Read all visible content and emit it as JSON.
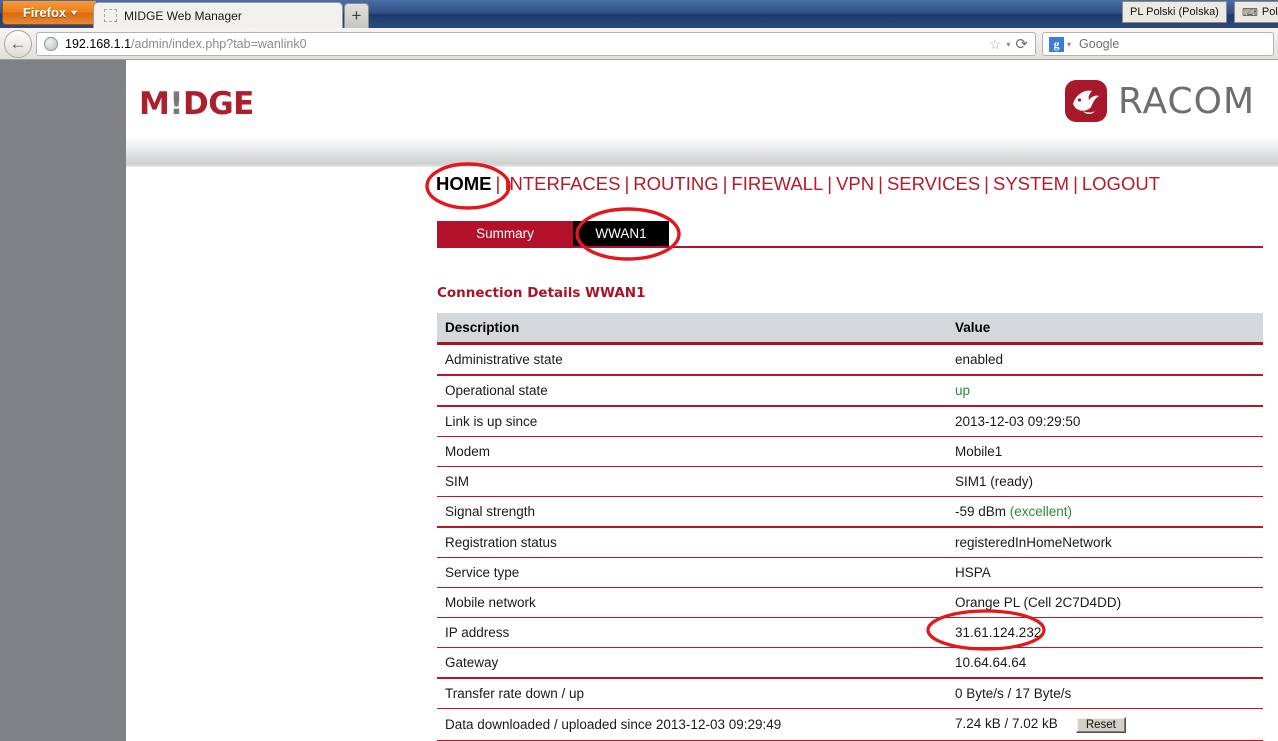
{
  "browser": {
    "app_button": "Firefox",
    "tab_title": "MIDGE Web Manager",
    "new_tab": "+",
    "back_arrow": "←",
    "url_host": "192.168.1.1",
    "url_path": "/admin/index.php?tab=wanlink0",
    "star": "☆",
    "caret": "▾",
    "reload": "⟳",
    "search_engine_letter": "g",
    "search_placeholder": "Google",
    "lang_locale": "PL Polski (Polska)",
    "lang_keyboard": "Pols",
    "keyboard_glyph": "⌨"
  },
  "brand": {
    "logo_m": "M",
    "logo_bang": "!",
    "logo_rest": "DGE",
    "racom_word": "RACOM"
  },
  "mainnav": {
    "items": [
      {
        "label": "HOME",
        "active": true
      },
      {
        "label": "INTERFACES",
        "active": false
      },
      {
        "label": "ROUTING",
        "active": false
      },
      {
        "label": "FIREWALL",
        "active": false
      },
      {
        "label": "VPN",
        "active": false
      },
      {
        "label": "SERVICES",
        "active": false
      },
      {
        "label": "SYSTEM",
        "active": false
      },
      {
        "label": "LOGOUT",
        "active": false
      }
    ],
    "separator": "|"
  },
  "subtabs": [
    {
      "label": "Summary",
      "active": false
    },
    {
      "label": "WWAN1",
      "active": true
    }
  ],
  "main": {
    "section_title": "Connection Details WWAN1",
    "table": {
      "headers": [
        "Description",
        "Value"
      ],
      "rows": [
        {
          "description": "Administrative state",
          "value": "enabled"
        },
        {
          "description": "Operational state",
          "value": "up",
          "value_color": "green"
        },
        {
          "description": "Link is up since",
          "value": "2013-12-03 09:29:50"
        },
        {
          "description": "Modem",
          "value": "Mobile1"
        },
        {
          "description": "SIM",
          "value": "SIM1 (ready)"
        },
        {
          "description": "Signal strength",
          "value": "-59 dBm ",
          "value_suffix": "(excellent)",
          "suffix_color": "green"
        },
        {
          "description": "Registration status",
          "value": "registeredInHomeNetwork"
        },
        {
          "description": "Service type",
          "value": "HSPA"
        },
        {
          "description": "Mobile network",
          "value": "Orange PL (Cell 2C7D4DD)"
        },
        {
          "description": "IP address",
          "value": "31.61.124.232"
        },
        {
          "description": "Gateway",
          "value": "10.64.64.64"
        },
        {
          "description": "Transfer rate down / up",
          "value": "0 Byte/s / 17 Byte/s"
        },
        {
          "description": "Data downloaded / uploaded since 2013-12-03 09:29:49",
          "value": "7.24 kB / 7.02 kB",
          "button": "Reset"
        }
      ]
    }
  },
  "annotations": {
    "home_circle": "ellipse around HOME nav item",
    "wwan1_circle": "ellipse around WWAN1 tab",
    "ip_circle": "ellipse around IP address value"
  },
  "colors": {
    "brand_red": "#ab1f2e",
    "nav_red": "#b31b28",
    "table_rule": "#b8162b",
    "annotation_red": "#e2181d",
    "status_green": "#2e8b37",
    "header_gray": "#d4d8da",
    "gutter_gray": "#808184"
  }
}
